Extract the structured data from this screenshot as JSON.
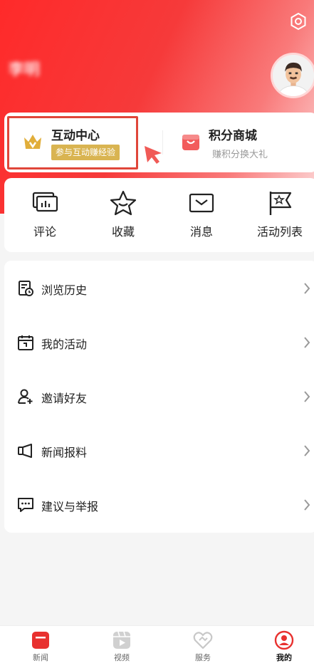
{
  "header": {
    "username": "李明"
  },
  "interaction_center": {
    "title": "互动中心",
    "badge": "参与互动赚经验"
  },
  "points_mall": {
    "title": "积分商城",
    "subtitle": "赚积分换大礼"
  },
  "quick_actions": [
    {
      "label": "评论",
      "icon": "comment-icon"
    },
    {
      "label": "收藏",
      "icon": "star-icon"
    },
    {
      "label": "消息",
      "icon": "mail-icon"
    },
    {
      "label": "活动列表",
      "icon": "flag-icon"
    }
  ],
  "menu": [
    {
      "label": "浏览历史",
      "icon": "history-icon"
    },
    {
      "label": "我的活动",
      "icon": "calendar-icon"
    },
    {
      "label": "邀请好友",
      "icon": "add-user-icon"
    },
    {
      "label": "新闻报料",
      "icon": "megaphone-icon"
    },
    {
      "label": "建议与举报",
      "icon": "feedback-icon"
    }
  ],
  "tabs": [
    {
      "label": "新闻",
      "icon": "news-icon"
    },
    {
      "label": "视频",
      "icon": "video-icon"
    },
    {
      "label": "服务",
      "icon": "service-icon"
    },
    {
      "label": "我的",
      "icon": "profile-icon",
      "active": true
    }
  ],
  "colors": {
    "brand_red": "#ff2a2a",
    "badge_gold": "#d9b451",
    "highlight_border": "#e0463a"
  }
}
